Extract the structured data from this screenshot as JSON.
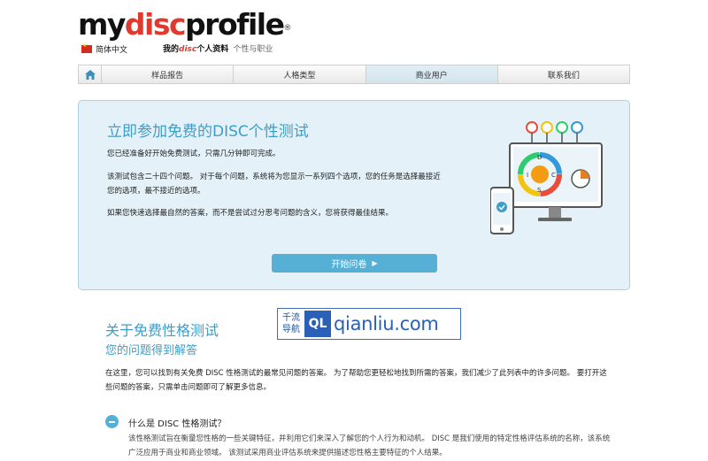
{
  "header": {
    "logo": {
      "my": "my",
      "disc": "disc",
      "profile": "profile",
      "reg": "®"
    },
    "language": "简体中文",
    "tagline": {
      "prefix": "我的",
      "disc": "disc",
      "middle": "个人资料",
      "sub": "个性与职业"
    }
  },
  "nav": {
    "items": [
      {
        "label": "样品报告"
      },
      {
        "label": "人格类型"
      },
      {
        "label": "商业用户"
      },
      {
        "label": "联系我们"
      }
    ]
  },
  "hero": {
    "title": "立即参加免费的DISC个性测试",
    "p1": "您已经准备好开始免费测试，只需几分钟即可完成。",
    "p2": "该测试包含二十四个问题。 对于每个问题，系统将为您显示一系列四个选项，您的任务是选择最接近您的选项，最不接近的选项。",
    "p3": "如果您快速选择最自然的答案，而不是尝试过分思考问题的含义，您将获得最佳结果。",
    "button": "开始问卷",
    "disc_letters": {
      "d": "D",
      "i": "I",
      "s": "S",
      "c": "C"
    }
  },
  "about": {
    "title": "关于免费性格测试",
    "subtitle": "您的问题得到解答",
    "intro": "在这里，您可以找到有关免费 DISC 性格测试的最常见问题的答案。 为了帮助您更轻松地找到所需的答案，我们减少了此列表中的许多问题。 要打开这些问题的答案，只需单击问题即可了解更多信息。"
  },
  "watermark": {
    "cn_top": "千流",
    "cn_bottom": "导航",
    "badge": "QL",
    "url": "qianliu.com"
  },
  "faq": {
    "question": "什么是 DISC 性格测试？",
    "answer": "该性格测试旨在衡量您性格的一些关键特征，并利用它们来深入了解您的个人行为和动机。 DISC 是我们使用的特定性格评估系统的名称，该系统广泛应用于商业和商业领域。 该测试采用商业评估系统来提供描述您性格主要特征的个人结果。"
  },
  "colors": {
    "accent": "#3c9ec9",
    "button": "#56b0d6",
    "hero_bg": "#e4f1f8",
    "logo_red": "#e03a2f"
  }
}
